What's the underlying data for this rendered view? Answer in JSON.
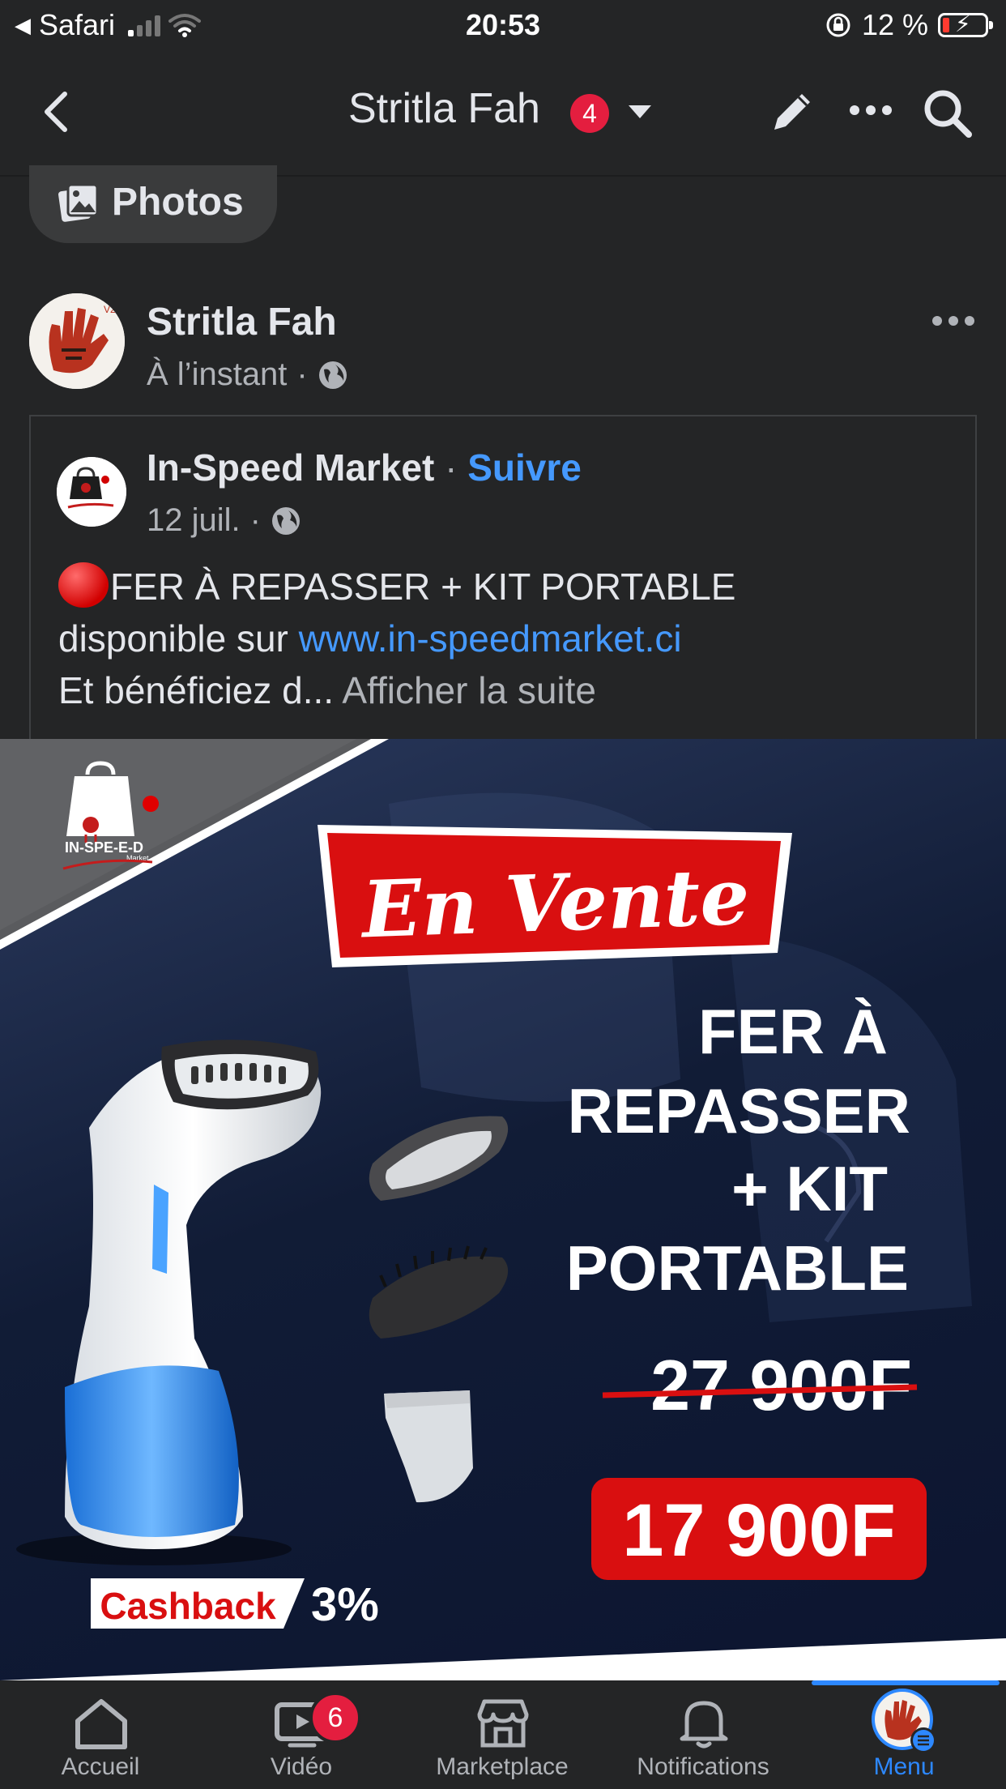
{
  "status_bar": {
    "back_app": "Safari",
    "time": "20:53",
    "battery": "12 %",
    "battery_level": 0.12
  },
  "header": {
    "title": "Stritla Fah",
    "badge": "4"
  },
  "photos_chip": {
    "label": "Photos"
  },
  "post": {
    "author": "Stritla Fah",
    "time": "À l’instant",
    "shared": {
      "page_name": "In-Speed Market",
      "separator": "·",
      "follow": "Suivre",
      "date": "12 juil.",
      "dot": "·",
      "text_line1": "FER À REPASSER + KIT PORTABLE",
      "text_line2_prefix": "disponible sur ",
      "link": "www.in-speedmarket.ci",
      "text_line3": "Et bénéficiez d...",
      "see_more": "Afficher la suite"
    }
  },
  "ad": {
    "brand": "IN-SPE-E-D",
    "brand_sub": "Market",
    "banner": "En Vente",
    "product_line1": "FER À",
    "product_line2": "REPASSER",
    "product_line3": "+ KIT",
    "product_line4": "PORTABLE",
    "old_price": "27 900F",
    "new_price": "17 900F",
    "cashback_label": "Cashback",
    "cashback_value": "3%"
  },
  "tabs": [
    {
      "label": "Accueil",
      "icon": "home-icon"
    },
    {
      "label": "Vidéo",
      "icon": "video-icon",
      "badge": "6"
    },
    {
      "label": "Marketplace",
      "icon": "marketplace-icon"
    },
    {
      "label": "Notifications",
      "icon": "bell-icon"
    },
    {
      "label": "Menu",
      "icon": "menu-avatar-icon",
      "active": true
    }
  ],
  "colors": {
    "background": "#242526",
    "accent_blue": "#2d88ff",
    "link_blue": "#4599ff",
    "badge_red": "#e41e3f",
    "ad_red": "#d90f10"
  }
}
